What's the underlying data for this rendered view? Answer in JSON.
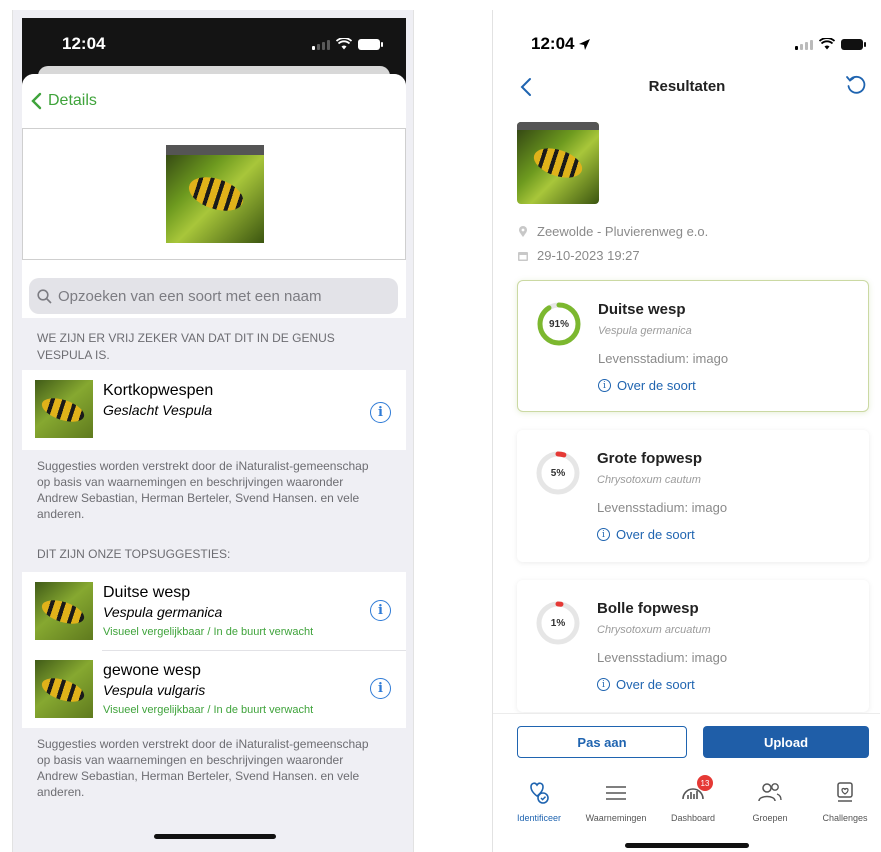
{
  "left": {
    "status_time": "12:04",
    "back_label": "Details",
    "search_placeholder": "Opzoeken van een soort met een naam",
    "genus_heading": "WE ZIJN ER VRIJ ZEKER VAN DAT DIT IN DE GENUS VESPULA IS.",
    "genus_item": {
      "name": "Kortkopwespen",
      "sub": "Geslacht Vespula"
    },
    "note": "Suggesties worden verstrekt door de iNaturalist-gemeenschap op basis van waarnemingen en beschrijvingen waaronder Andrew Sebastian, Herman Berteler, Svend Hansen. en vele anderen.",
    "top_heading": "DIT ZIJN ONZE TOPSUGGESTIES:",
    "suggestions": [
      {
        "name": "Duitse wesp",
        "sub": "Vespula germanica",
        "tag": "Visueel vergelijkbaar / In de buurt verwacht"
      },
      {
        "name": "gewone wesp",
        "sub": "Vespula vulgaris",
        "tag": "Visueel vergelijkbaar / In de buurt verwacht"
      }
    ],
    "info_glyph": "i"
  },
  "right": {
    "status_time": "12:04",
    "nav_title": "Resultaten",
    "location": "Zeewolde - Pluvierenweg e.o.",
    "datetime": "29-10-2023 19:27",
    "results": [
      {
        "pct": 91,
        "pct_label": "91%",
        "name": "Duitse wesp",
        "sci": "Vespula germanica",
        "stage": "Levensstadium: imago",
        "about": "Over de soort",
        "color": "#7cb82f"
      },
      {
        "pct": 5,
        "pct_label": "5%",
        "name": "Grote fopwesp",
        "sci": "Chrysotoxum cautum",
        "stage": "Levensstadium: imago",
        "about": "Over de soort",
        "color": "#e53935"
      },
      {
        "pct": 1,
        "pct_label": "1%",
        "name": "Bolle fopwesp",
        "sci": "Chrysotoxum arcuatum",
        "stage": "Levensstadium: imago",
        "about": "Over de soort",
        "color": "#e53935"
      }
    ],
    "btn_edit": "Pas aan",
    "btn_upload": "Upload",
    "tabs": [
      {
        "label": "Identificeer"
      },
      {
        "label": "Waarnemingen"
      },
      {
        "label": "Dashboard",
        "badge": "13"
      },
      {
        "label": "Groepen"
      },
      {
        "label": "Challenges"
      }
    ],
    "colors": {
      "accent": "#1f64b0",
      "accent_fill": "#1f5ea8",
      "green": "#7cb82f",
      "red": "#e53935"
    }
  }
}
